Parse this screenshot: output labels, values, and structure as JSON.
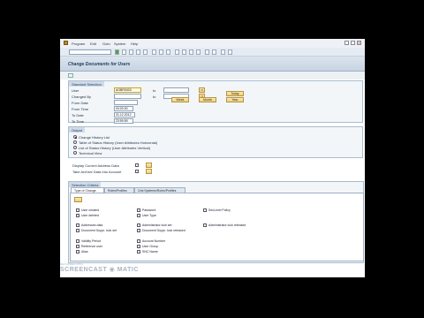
{
  "menu": {
    "items": [
      "Program",
      "Edit",
      "Goto",
      "System",
      "Help"
    ]
  },
  "title": "Change Documents for Users",
  "standard_selection": {
    "title": "Standard Selection",
    "labels": [
      "User",
      "Changed By",
      "From Date",
      "From Time",
      "To Date",
      "To Time"
    ],
    "user_value": "AGBR0003",
    "from_time_value": "00:00:00",
    "to_date_value": "31.12.2012",
    "to_time_value": "23:59:59",
    "to_label": "to",
    "multi_sel": "⇒",
    "today_button": "Today",
    "week_button": "Week",
    "month_button": "Month",
    "year_button": "Year"
  },
  "output": {
    "title": "Output",
    "options": [
      "Change History List",
      "Table of Status History (User Attributes Horizontal)",
      "List of Status History (User Attributes Vertical)",
      "Technical View"
    ],
    "selected_index": 0,
    "display_address": "Display Current Address Data",
    "take_archive": "Take Archive Data Into Account"
  },
  "selection_criteria": {
    "title": "Selection Criteria",
    "tabs": [
      "Type of Change",
      "Roles/Profiles",
      "Cntr.Systems/Roles/Profiles"
    ],
    "col1": [
      "User created",
      "User deleted",
      "Addresses data",
      "Document Suppr. lock set",
      "Validity Period",
      "Reference user",
      "Alias"
    ],
    "col2": [
      "Password",
      "User Type",
      "Administrator lock set",
      "Document Suppr. lock released",
      "Account Number",
      "User Group",
      "SNC Name"
    ],
    "col3": [
      "SecLevel Policy",
      "Administrator lock released"
    ]
  },
  "watermark": {
    "top": "RECORDED WITH",
    "bottom": "SCREENCAST ◉ MATIC"
  }
}
